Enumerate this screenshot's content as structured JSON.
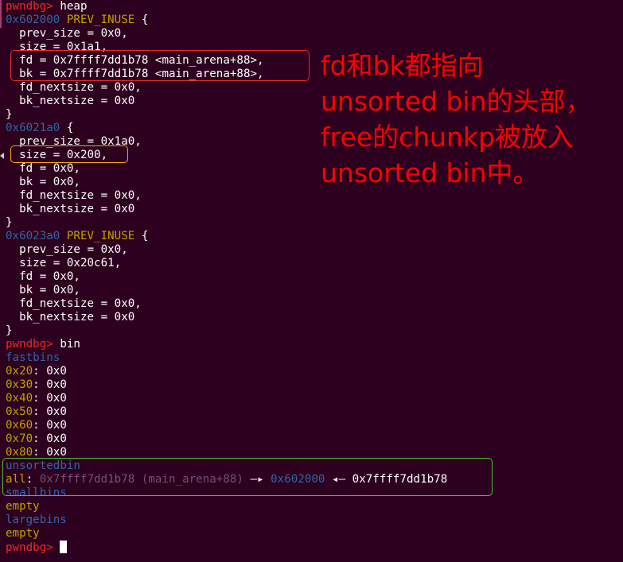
{
  "heap_cmd": {
    "prompt": "pwndbg>",
    "cmd": " heap"
  },
  "chunk1": {
    "addr": "0x602000",
    "flag": "PREV_INUSE",
    "brace": " {",
    "prev_size": "  prev_size = 0x0,",
    "size": "  size = 0x1a1,",
    "fd": "  fd = 0x7ffff7dd1b78 <main_arena+88>,",
    "bk": "  bk = 0x7ffff7dd1b78 <main_arena+88>,",
    "fd_nextsize": "  fd_nextsize = 0x0,",
    "bk_nextsize": "  bk_nextsize = 0x0",
    "close": "}"
  },
  "chunk2": {
    "addr": "0x6021a0",
    "brace": " {",
    "prev_size": "  prev_size = 0x1a0,",
    "size": "  size = 0x200,",
    "fd": "  fd = 0x0,",
    "bk": "  bk = 0x0,",
    "fd_nextsize": "  fd_nextsize = 0x0,",
    "bk_nextsize": "  bk_nextsize = 0x0",
    "close": "}"
  },
  "chunk3": {
    "addr": "0x6023a0",
    "flag": "PREV_INUSE",
    "brace": " {",
    "prev_size": "  prev_size = 0x0,",
    "size": "  size = 0x20c61,",
    "fd": "  fd = 0x0,",
    "bk": "  bk = 0x0,",
    "fd_nextsize": "  fd_nextsize = 0x0,",
    "bk_nextsize": "  bk_nextsize = 0x0",
    "close": "}"
  },
  "bin_cmd": {
    "prompt": "pwndbg>",
    "cmd": " bin"
  },
  "fastbins": {
    "title": "fastbins",
    "rows": [
      {
        "size": "0x20",
        "val": ": 0x0"
      },
      {
        "size": "0x30",
        "val": ": 0x0"
      },
      {
        "size": "0x40",
        "val": ": 0x0"
      },
      {
        "size": "0x50",
        "val": ": 0x0"
      },
      {
        "size": "0x60",
        "val": ": 0x0"
      },
      {
        "size": "0x70",
        "val": ": 0x0"
      },
      {
        "size": "0x80",
        "val": ": 0x0"
      }
    ]
  },
  "unsortedbin": {
    "title": "unsortedbin",
    "all": "all",
    "colon": ": ",
    "head": "0x7ffff7dd1b78 (main_arena+88)",
    "arrow1": " —▸ ",
    "chunk": "0x602000",
    "arrow2": " ◂— ",
    "tail": "0x7ffff7dd1b78"
  },
  "smallbins": {
    "title": "smallbins",
    "value": "empty"
  },
  "largebins": {
    "title": "largebins",
    "value": "empty"
  },
  "final_prompt": "pwndbg>",
  "annotation": "fd和bk都指向\nunsorted bin的头部，\nfree的chunkp被放入\nunsorted bin中。",
  "colors": {
    "background": "#2c001e",
    "red_box": "#ef2929",
    "orange_box": "#f5a800",
    "green_box": "#4cc23a"
  }
}
